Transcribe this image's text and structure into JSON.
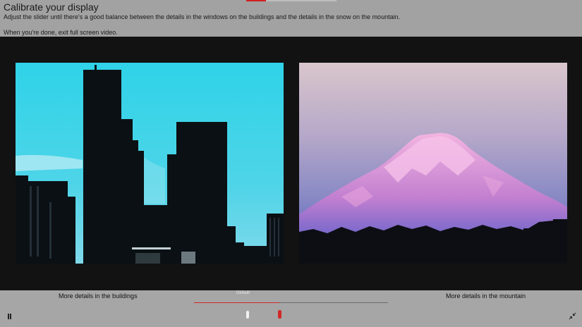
{
  "header": {
    "title": "Calibrate your display",
    "instruction": "Adjust the slider until there's a good balance between the details in the windows on the buildings and the details in the snow on the mountain.",
    "instruction2": "When you're done, exit full screen video."
  },
  "controls": {
    "label_buildings": "More details in the buildings",
    "label_mountain": "More details in the mountain",
    "default_label": "Default",
    "slider_value": 0.44,
    "default_value": 0.275
  },
  "icons": {
    "pause": "pause-icon",
    "exit_fullscreen": "exit-fullscreen-icon"
  },
  "colors": {
    "accent": "#d22828",
    "header_bg": "#a2a2a2",
    "video_bg": "#121212"
  }
}
